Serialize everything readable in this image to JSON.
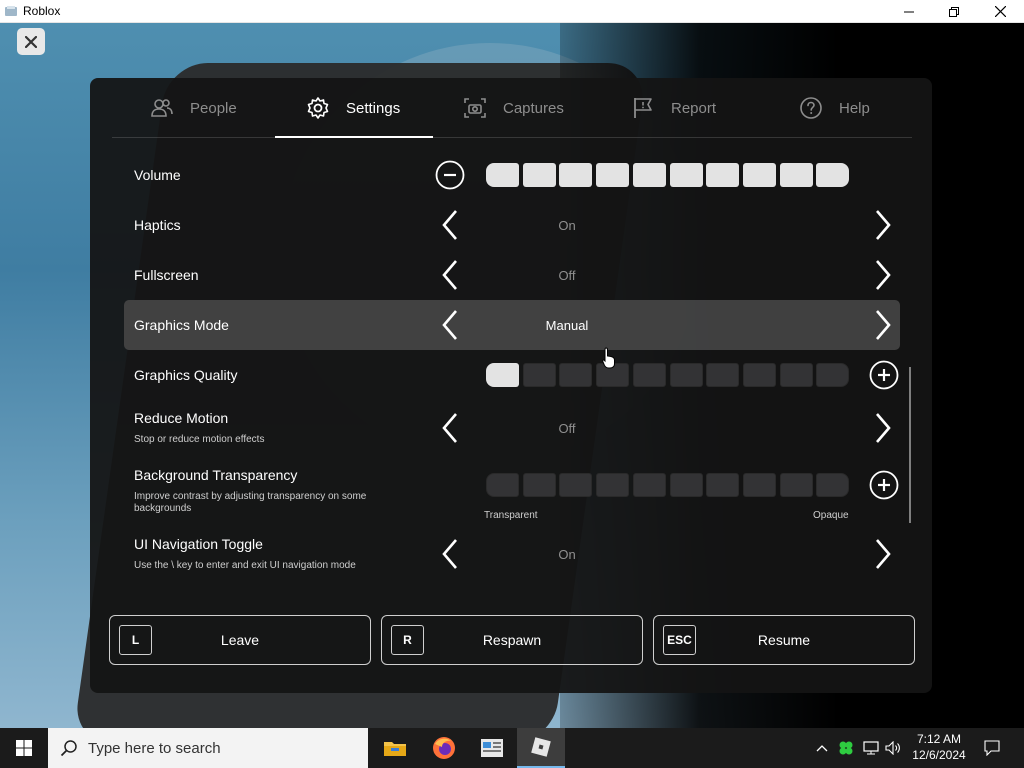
{
  "window": {
    "title": "Roblox",
    "icon": "roblox-window-icon",
    "controls": [
      "minimize-icon",
      "restore-icon",
      "close-icon"
    ]
  },
  "game": {
    "close_icon": "close-icon"
  },
  "tabs": [
    {
      "label": "People",
      "icon": "people-icon",
      "active": false
    },
    {
      "label": "Settings",
      "icon": "gear-icon",
      "active": true
    },
    {
      "label": "Captures",
      "icon": "camera-icon",
      "active": false
    },
    {
      "label": "Report",
      "icon": "flag-icon",
      "active": false
    },
    {
      "label": "Help",
      "icon": "question-icon",
      "active": false
    }
  ],
  "settings": {
    "volume": {
      "label": "Volume",
      "level": 10,
      "max": 10
    },
    "haptics": {
      "label": "Haptics",
      "value": "On"
    },
    "fullscreen": {
      "label": "Fullscreen",
      "value": "Off"
    },
    "graphics_mode": {
      "label": "Graphics Mode",
      "value": "Manual",
      "highlighted": true
    },
    "graphics_quality": {
      "label": "Graphics Quality",
      "level": 1,
      "max": 10
    },
    "reduce_motion": {
      "label": "Reduce Motion",
      "sublabel": "Stop or reduce motion effects",
      "value": "Off"
    },
    "background_transparency": {
      "label": "Background Transparency",
      "sublabel": "Improve contrast by adjusting transparency on some backgrounds",
      "level": 0,
      "max": 10,
      "min_caption": "Transparent",
      "max_caption": "Opaque"
    },
    "ui_navigation_toggle": {
      "label": "UI Navigation Toggle",
      "sublabel": "Use the \\ key to enter and exit UI navigation mode",
      "value": "On"
    }
  },
  "actions": [
    {
      "key": "L",
      "label": "Leave"
    },
    {
      "key": "R",
      "label": "Respawn"
    },
    {
      "key": "ESC",
      "label": "Resume"
    }
  ],
  "taskbar": {
    "search_placeholder": "Type here to search",
    "apps": [
      "file-explorer-icon",
      "firefox-icon",
      "news-app-icon",
      "roblox-app-icon"
    ],
    "active_app": "roblox-app-icon",
    "time": "7:12 AM",
    "date": "12/6/2024"
  },
  "colors": {
    "panel_bg": "#141414",
    "segment_on": "#e3e3e3",
    "segment_off": "#333335",
    "highlight_row": "#464646",
    "taskbar_bg": "#1b1b1b"
  }
}
